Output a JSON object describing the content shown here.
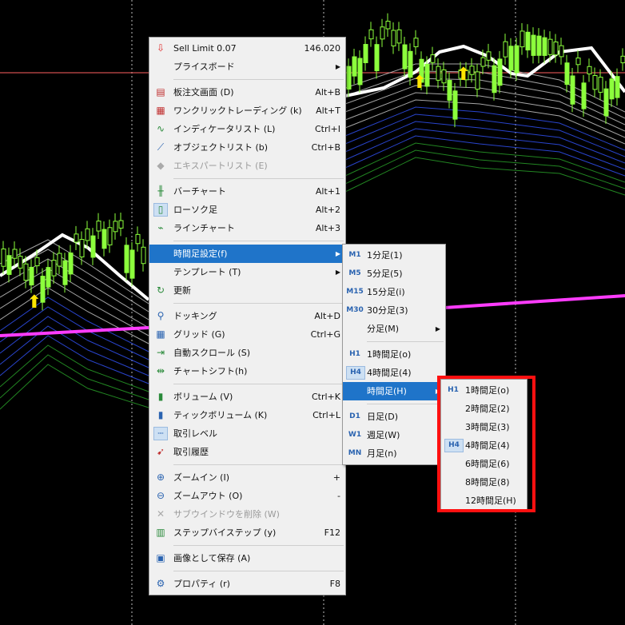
{
  "main_menu": [
    {
      "type": "item",
      "name": "sell-limit",
      "icon": "arrow-down-icon",
      "label": "Sell Limit 0.07",
      "shortcut": "146.020"
    },
    {
      "type": "item",
      "name": "price-board",
      "label": "プライスボード",
      "submenu": true
    },
    {
      "type": "sep"
    },
    {
      "type": "item",
      "name": "order-board",
      "icon": "order-book-icon",
      "label": "板注文画面 (D)",
      "shortcut": "Alt+B"
    },
    {
      "type": "item",
      "name": "one-click-trading",
      "icon": "one-click-icon",
      "label": "ワンクリックトレーディング (k)",
      "shortcut": "Alt+T"
    },
    {
      "type": "item",
      "name": "indicator-list",
      "icon": "indicator-icon",
      "label": "インディケータリスト (L)",
      "shortcut": "Ctrl+I"
    },
    {
      "type": "item",
      "name": "object-list",
      "icon": "object-icon",
      "label": "オブジェクトリスト (b)",
      "shortcut": "Ctrl+B"
    },
    {
      "type": "item",
      "name": "expert-list",
      "icon": "expert-icon",
      "label": "エキスパートリスト (E)",
      "disabled": true
    },
    {
      "type": "sep"
    },
    {
      "type": "item",
      "name": "bar-chart",
      "icon": "bar-chart-icon",
      "label": "バーチャート",
      "shortcut": "Alt+1"
    },
    {
      "type": "item",
      "name": "candlestick",
      "icon": "candle-icon",
      "label": "ローソク足",
      "shortcut": "Alt+2",
      "checked": true
    },
    {
      "type": "item",
      "name": "line-chart",
      "icon": "line-chart-icon",
      "label": "ラインチャート",
      "shortcut": "Alt+3"
    },
    {
      "type": "sep"
    },
    {
      "type": "item",
      "name": "timeframe-settings",
      "label": "時間足設定(f)",
      "submenu": true,
      "highlight": true
    },
    {
      "type": "item",
      "name": "template",
      "label": "テンプレート (T)",
      "submenu": true
    },
    {
      "type": "item",
      "name": "refresh",
      "icon": "refresh-icon",
      "label": "更新"
    },
    {
      "type": "sep"
    },
    {
      "type": "item",
      "name": "docking",
      "icon": "pin-icon",
      "label": "ドッキング",
      "shortcut": "Alt+D"
    },
    {
      "type": "item",
      "name": "grid",
      "icon": "grid-icon",
      "label": "グリッド (G)",
      "shortcut": "Ctrl+G"
    },
    {
      "type": "item",
      "name": "auto-scroll",
      "icon": "auto-scroll-icon",
      "label": "自動スクロール (S)"
    },
    {
      "type": "item",
      "name": "chart-shift",
      "icon": "chart-shift-icon",
      "label": "チャートシフト(h)"
    },
    {
      "type": "sep"
    },
    {
      "type": "item",
      "name": "volume",
      "icon": "volume-icon",
      "label": "ボリューム (V)",
      "shortcut": "Ctrl+K"
    },
    {
      "type": "item",
      "name": "tick-volume",
      "icon": "tick-volume-icon",
      "label": "ティックボリューム (K)",
      "shortcut": "Ctrl+L"
    },
    {
      "type": "item",
      "name": "trade-levels",
      "icon": "trade-level-icon",
      "label": "取引レベル",
      "checked": true
    },
    {
      "type": "item",
      "name": "trade-history",
      "icon": "history-icon",
      "label": "取引履歴"
    },
    {
      "type": "sep"
    },
    {
      "type": "item",
      "name": "zoom-in",
      "icon": "zoom-in-icon",
      "label": "ズームイン (I)",
      "shortcut": "+"
    },
    {
      "type": "item",
      "name": "zoom-out",
      "icon": "zoom-out-icon",
      "label": "ズームアウト (O)",
      "shortcut": "-"
    },
    {
      "type": "item",
      "name": "delete-subwindow",
      "icon": "close-icon",
      "label": "サブウインドウを削除 (W)",
      "disabled": true
    },
    {
      "type": "item",
      "name": "step-by-step",
      "icon": "step-icon",
      "label": "ステップバイステップ (y)",
      "shortcut": "F12"
    },
    {
      "type": "sep"
    },
    {
      "type": "item",
      "name": "save-as-image",
      "icon": "image-icon",
      "label": "画像として保存 (A)"
    },
    {
      "type": "sep"
    },
    {
      "type": "item",
      "name": "properties",
      "icon": "gear-icon",
      "label": "プロパティ (r)",
      "shortcut": "F8"
    }
  ],
  "timeframe_menu": [
    {
      "type": "item",
      "name": "m1",
      "code": "M1",
      "label": "1分足(1)"
    },
    {
      "type": "item",
      "name": "m5",
      "code": "M5",
      "label": "5分足(5)"
    },
    {
      "type": "item",
      "name": "m15",
      "code": "M15",
      "label": "15分足(i)"
    },
    {
      "type": "item",
      "name": "m30",
      "code": "M30",
      "label": "30分足(3)"
    },
    {
      "type": "item",
      "name": "minutes",
      "code": "",
      "label": "分足(M)",
      "submenu": true
    },
    {
      "type": "sep"
    },
    {
      "type": "item",
      "name": "h1",
      "code": "H1",
      "label": "1時間足(o)"
    },
    {
      "type": "item",
      "name": "h4",
      "code": "H4",
      "label": "4時間足(4)",
      "selected": true
    },
    {
      "type": "item",
      "name": "hours",
      "code": "",
      "label": "時間足(H)",
      "submenu": true,
      "highlight": true
    },
    {
      "type": "sep"
    },
    {
      "type": "item",
      "name": "d1",
      "code": "D1",
      "label": "日足(D)"
    },
    {
      "type": "item",
      "name": "w1",
      "code": "W1",
      "label": "週足(W)"
    },
    {
      "type": "item",
      "name": "mn",
      "code": "MN",
      "label": "月足(n)"
    }
  ],
  "hours_menu": [
    {
      "type": "item",
      "name": "h1",
      "code": "H1",
      "label": "1時間足(o)"
    },
    {
      "type": "item",
      "name": "h2",
      "code": "",
      "label": "2時間足(2)"
    },
    {
      "type": "item",
      "name": "h3",
      "code": "",
      "label": "3時間足(3)"
    },
    {
      "type": "item",
      "name": "h4",
      "code": "H4",
      "label": "4時間足(4)",
      "selected": true
    },
    {
      "type": "item",
      "name": "h6",
      "code": "",
      "label": "6時間足(6)"
    },
    {
      "type": "item",
      "name": "h8",
      "code": "",
      "label": "8時間足(8)"
    },
    {
      "type": "item",
      "name": "h12",
      "code": "",
      "label": "12時間足(H)"
    }
  ],
  "colors": {
    "highlight": "#1f74c9",
    "annotation_box": "#ff1010",
    "ma_main": "#ffffff",
    "ma_slow": "#ff3cff",
    "candle": "#8cff3c",
    "price_line": "#ff6060"
  }
}
